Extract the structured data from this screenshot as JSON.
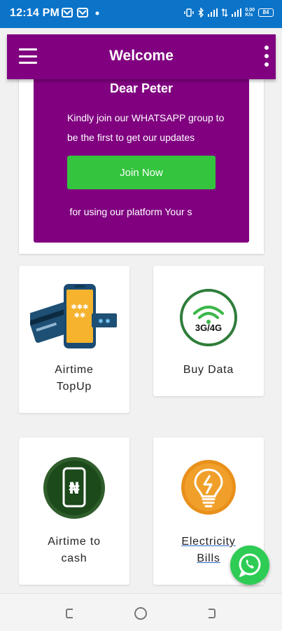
{
  "status_bar": {
    "time": "12:14 PM",
    "left_icons": [
      "mail-icon",
      "mail-icon",
      "dot-icon"
    ],
    "network_label_top": "4G",
    "speed": "0.00",
    "speed_unit": "K/s",
    "battery": "84"
  },
  "app_bar": {
    "title": "Welcome",
    "menu_icon": "hamburger-menu-icon",
    "more_icon": "more-vert-icon"
  },
  "banner": {
    "greeting": "Dear Peter",
    "line1": "Kindly join our WHATSAPP group to",
    "line2": "be the first to get our updates",
    "button_label": "Join Now",
    "marquee_text": "ou for using our platform Your s"
  },
  "services": [
    {
      "label_line1": "Airtime",
      "label_line2": "TopUp",
      "icon": "phone-card-icon"
    },
    {
      "label_line1": "Buy Data",
      "label_line2": "",
      "icon": "3g-4g-icon",
      "icon_text": "3G/4G"
    },
    {
      "label_line1": "Airtime to",
      "label_line2": "cash",
      "icon": "naira-phone-icon"
    },
    {
      "label_line1": "Electricity",
      "label_line2": "Bills",
      "icon": "lightbulb-icon"
    }
  ],
  "fab": {
    "icon": "whatsapp-icon"
  },
  "nav": {
    "recent": "recent-apps-icon",
    "home": "home-icon",
    "back": "back-icon"
  },
  "colors": {
    "status_bar": "#0b74c9",
    "primary": "#800080",
    "join_button": "#34c43e",
    "whatsapp": "#2ecc55"
  }
}
